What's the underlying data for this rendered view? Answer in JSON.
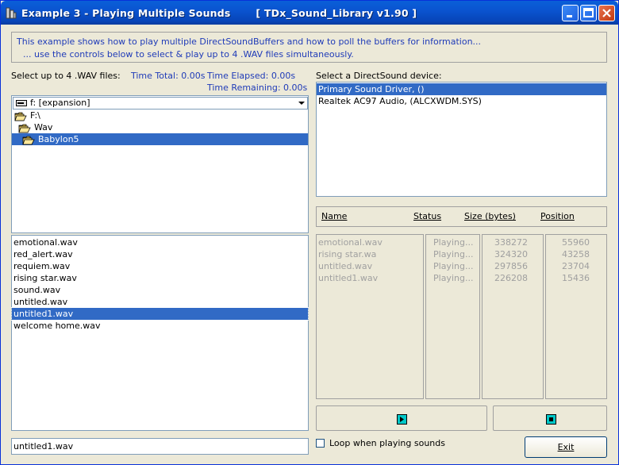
{
  "window": {
    "title": "Example 3 - Playing Multiple Sounds       [ TDx_Sound_Library v1.90 ]"
  },
  "info": {
    "line1": "This example shows how to play multiple DirectSoundBuffers and how to poll the buffers for information...",
    "line2": "... use the controls below to select & play up to 4 .WAV files simultaneously."
  },
  "files": {
    "label": "Select up to 4 .WAV files:",
    "time_total": "Time Total: 0.00s",
    "time_elapsed": "Time Elapsed: 0.00s",
    "time_remaining": "Time Remaining: 0.00s",
    "drive_value": "f: [expansion]",
    "folders": [
      {
        "name": "F:\\",
        "selected": false
      },
      {
        "name": "Wav",
        "selected": false
      },
      {
        "name": "Babylon5",
        "selected": true
      }
    ],
    "items": [
      {
        "name": "emotional.wav",
        "selected": false
      },
      {
        "name": "red_alert.wav",
        "selected": false
      },
      {
        "name": "requiem.wav",
        "selected": false
      },
      {
        "name": "rising star.wav",
        "selected": false
      },
      {
        "name": "sound.wav",
        "selected": false
      },
      {
        "name": "untitled.wav",
        "selected": false
      },
      {
        "name": "untitled1.wav",
        "selected": true
      },
      {
        "name": "welcome home.wav",
        "selected": false
      }
    ],
    "filename_value": "untitled1.wav"
  },
  "devices": {
    "label": "Select a DirectSound device:",
    "items": [
      {
        "name": "Primary Sound Driver, ()",
        "selected": true
      },
      {
        "name": "Realtek AC97 Audio, (ALCXWDM.SYS)",
        "selected": false
      }
    ]
  },
  "status_table": {
    "headers": {
      "name": "Name",
      "status": "Status",
      "size": "Size (bytes)",
      "position": "Position"
    },
    "rows": [
      {
        "name": "emotional.wav",
        "status": "Playing...",
        "size": "338272",
        "position": "55960"
      },
      {
        "name": "rising star.wa",
        "status": "Playing...",
        "size": "324320",
        "position": "43258"
      },
      {
        "name": "untitled.wav",
        "status": "Playing...",
        "size": "297856",
        "position": "23704"
      },
      {
        "name": "untitled1.wav",
        "status": "Playing...",
        "size": "226208",
        "position": "15436"
      }
    ]
  },
  "controls": {
    "loop_label": "Loop when playing sounds",
    "loop_checked": false,
    "exit_label": "Exit",
    "play_icon": "play-icon",
    "stop_icon": "stop-icon"
  },
  "colors": {
    "titlebar": "#0a54d0",
    "selection": "#316ac5",
    "info_text": "#1f3bb8",
    "face": "#ece9d8"
  }
}
